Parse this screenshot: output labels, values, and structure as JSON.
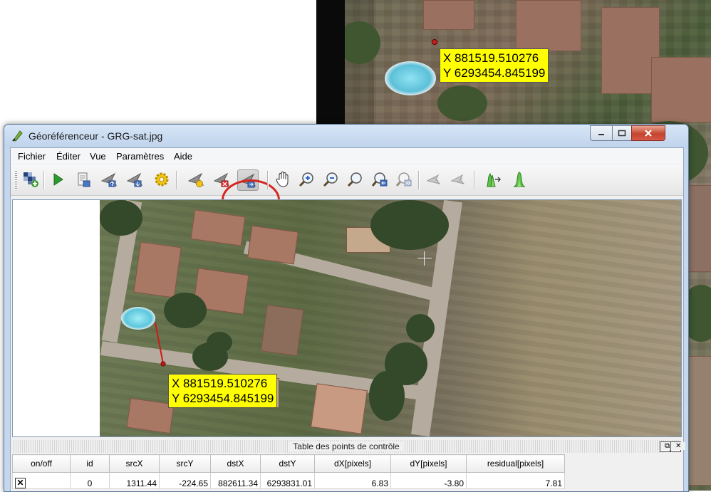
{
  "window": {
    "title": "Géoréférenceur - GRG-sat.jpg",
    "accent_color": "#c4d7ee",
    "close_color": "#c4452d"
  },
  "menu": {
    "items": [
      "Fichier",
      "Éditer",
      "Vue",
      "Paramètres",
      "Aide"
    ]
  },
  "toolbar": {
    "icons": [
      "open-raster-icon",
      "start-georeferencing-icon",
      "generate-gdal-script-icon",
      "load-gcp-points-icon",
      "save-gcp-points-icon",
      "transformation-settings-icon",
      "add-point-icon",
      "delete-point-icon",
      "move-gcp-point-icon",
      "pan-icon",
      "zoom-in-icon",
      "zoom-out-icon",
      "zoom-to-layer-icon",
      "zoom-last-icon",
      "zoom-next-icon",
      "link-georef-to-qgis-icon",
      "link-qgis-to-georef-icon",
      "full-histogram-stretch-icon",
      "local-histogram-stretch-icon"
    ],
    "active_tool": "move-gcp-point-icon",
    "highlight_color": "#d6261f"
  },
  "background_map": {
    "point_label": {
      "x": "X 881519.510276",
      "y": "Y 6293454.845199"
    }
  },
  "georef_canvas": {
    "point_label": {
      "x": "X 881519.510276",
      "y": "Y 6293454.845199"
    },
    "label_color": "#ffff00",
    "residual_line_color": "#d01818"
  },
  "gcp_dock": {
    "title": "Table des points de contrôle",
    "columns": [
      "on/off",
      "id",
      "srcX",
      "srcY",
      "dstX",
      "dstY",
      "dX[pixels]",
      "dY[pixels]",
      "residual[pixels]"
    ],
    "rows": [
      {
        "on": "✕",
        "id": "0",
        "srcX": "1311.44",
        "srcY": "-224.65",
        "dstX": "882611.34",
        "dstY": "6293831.01",
        "dX": "6.83",
        "dY": "-3.80",
        "residual": "7.81"
      }
    ]
  }
}
